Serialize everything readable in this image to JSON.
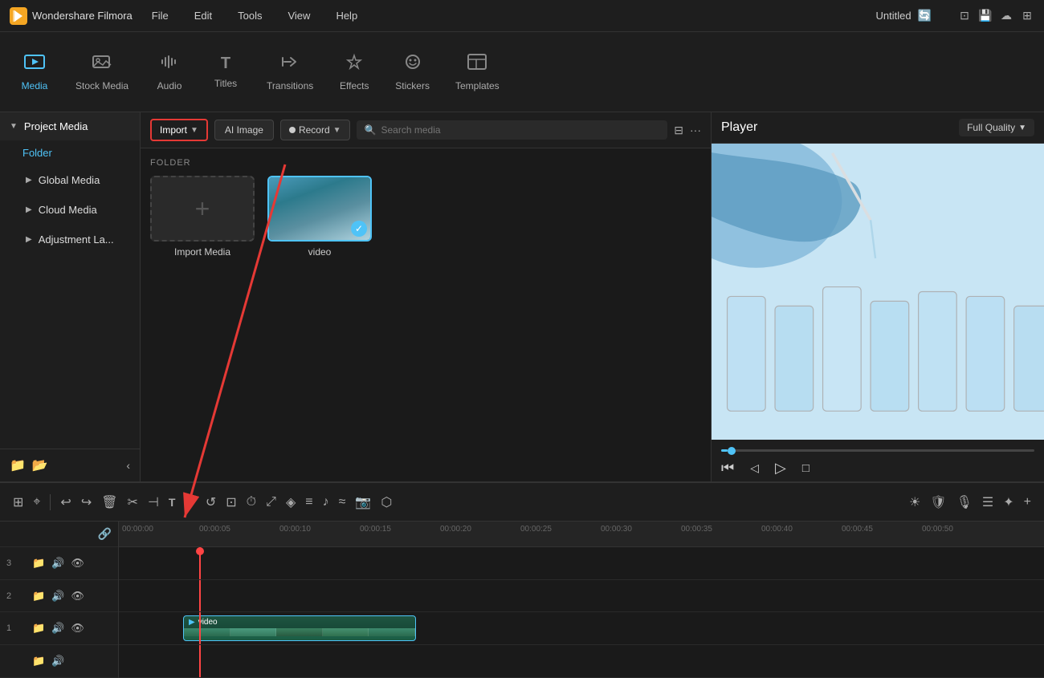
{
  "app": {
    "name": "Wondershare Filmora",
    "title": "Untitled"
  },
  "menu": {
    "items": [
      "File",
      "Edit",
      "Tools",
      "View",
      "Help"
    ]
  },
  "toolbar": {
    "items": [
      {
        "id": "media",
        "label": "Media",
        "icon": "🎬",
        "active": true
      },
      {
        "id": "stock-media",
        "label": "Stock Media",
        "icon": "🖼"
      },
      {
        "id": "audio",
        "label": "Audio",
        "icon": "🎵"
      },
      {
        "id": "titles",
        "label": "Titles",
        "icon": "T"
      },
      {
        "id": "transitions",
        "label": "Transitions",
        "icon": "↔"
      },
      {
        "id": "effects",
        "label": "Effects",
        "icon": "✨"
      },
      {
        "id": "stickers",
        "label": "Stickers",
        "icon": "😊"
      },
      {
        "id": "templates",
        "label": "Templates",
        "icon": "⊡"
      }
    ]
  },
  "sidebar": {
    "project_media_label": "Project Media",
    "folder_label": "Folder",
    "items": [
      {
        "label": "Global Media"
      },
      {
        "label": "Cloud Media"
      },
      {
        "label": "Adjustment La..."
      }
    ]
  },
  "content_toolbar": {
    "import_label": "Import",
    "ai_image_label": "AI Image",
    "record_label": "Record",
    "search_placeholder": "Search media",
    "folder_section": "FOLDER"
  },
  "media_items": [
    {
      "id": "import",
      "label": "Import Media",
      "type": "import"
    },
    {
      "id": "video",
      "label": "video",
      "type": "video",
      "selected": true
    }
  ],
  "player": {
    "label": "Player",
    "quality": "Full Quality"
  },
  "timeline": {
    "tracks": [
      {
        "num": "3",
        "icons": [
          "📁",
          "🔊",
          "👁"
        ]
      },
      {
        "num": "2",
        "icons": [
          "📁",
          "🔊",
          "👁"
        ]
      },
      {
        "num": "1",
        "icons": [
          "📁",
          "🔊",
          "👁"
        ]
      },
      {
        "num": "",
        "icons": [
          "📁",
          "🔊"
        ]
      }
    ],
    "ruler_marks": [
      "00:00:00",
      "00:00:05",
      "00:00:10",
      "00:00:15",
      "00:00:20",
      "00:00:25",
      "00:00:30",
      "00:00:35",
      "00:00:40",
      "00:00:45",
      "00:00:50"
    ],
    "clip": {
      "name": "video",
      "track": 1
    }
  }
}
